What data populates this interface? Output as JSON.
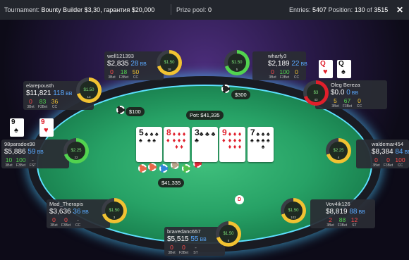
{
  "header": {
    "tournament_label": "Tournament:",
    "tournament_name": "Bounty Builder $3,30, гарантия $20,000",
    "prize_pool_label": "Prize pool:",
    "prize_pool_value": "0",
    "entries_label": "Entries:",
    "entries_value": "5407",
    "position_label": "Position:",
    "position_value": "130",
    "position_of": "of",
    "position_total": "3515",
    "close_icon": "close-icon"
  },
  "table": {
    "pot_label": "Pot: $41,335",
    "main_pot": "$41,335",
    "bet_300": "$300",
    "bet_100": "$100",
    "dealer_button": "D"
  },
  "board": [
    {
      "rank": "5",
      "suit": "♠",
      "color": "black"
    },
    {
      "rank": "8",
      "suit": "♦",
      "color": "red"
    },
    {
      "rank": "3",
      "suit": "♣",
      "color": "black"
    },
    {
      "rank": "9",
      "suit": "♦",
      "color": "red"
    },
    {
      "rank": "7",
      "suit": "♠",
      "color": "black"
    }
  ],
  "hero_cards": [
    {
      "rank": "Q",
      "suit": "♥",
      "color": "red"
    },
    {
      "rank": "Q",
      "suit": "♠",
      "color": "black"
    }
  ],
  "left_cards": [
    {
      "rank": "9",
      "suit": "♠",
      "color": "black"
    },
    {
      "rank": "9",
      "suit": "♥",
      "color": "red"
    }
  ],
  "seats": [
    {
      "name": "well121393",
      "stack": "$2,835",
      "bb": "28",
      "unit": "BB",
      "stats": [
        [
          "0",
          "r",
          "3Bet"
        ],
        [
          "18",
          "g",
          "F3Bet"
        ],
        [
          "50",
          "y",
          "CC"
        ]
      ],
      "ring": "$1.50",
      "ring_num": "18"
    },
    {
      "name": "wharfy3",
      "stack": "$2,189",
      "bb": "22",
      "unit": "BB",
      "stats": [
        [
          "0",
          "r",
          "3Bet"
        ],
        [
          "100",
          "g",
          "F3Bet"
        ],
        [
          "0",
          "y",
          "CC"
        ]
      ],
      "ring": "$1.50",
      "ring_num": "5"
    },
    {
      "name": "elarepousth",
      "stack": "$11,821",
      "bb": "118",
      "unit": "BB",
      "stats": [
        [
          "0",
          "r",
          "3Bet"
        ],
        [
          "83",
          "g",
          "F3Bet"
        ],
        [
          "36",
          "y",
          "CC"
        ]
      ],
      "ring": "$1.50",
      "ring_num": "13"
    },
    {
      "name": "Oleg Bereza",
      "stack": "$0.0",
      "bb": "0",
      "unit": "BB",
      "stats": [
        [
          "5",
          "y",
          "3Bet"
        ],
        [
          "67",
          "g",
          "F3Bet"
        ],
        [
          "0",
          "y",
          "CC"
        ]
      ],
      "ring": "$3",
      "ring_num": "43"
    },
    {
      "name": "98paradox98",
      "stack": "$5,886",
      "bb": "59",
      "unit": "BB",
      "stats": [
        [
          "10",
          "g",
          "3Bet"
        ],
        [
          "100",
          "g",
          "F3Bet"
        ],
        [
          "-",
          "gr",
          "FST"
        ]
      ],
      "ring": "$2.25",
      "ring_num": "22"
    },
    {
      "name": "waldemar454",
      "stack": "$8,384",
      "bb": "84",
      "unit": "BB",
      "stats": [
        [
          "0",
          "r",
          "3Bet"
        ],
        [
          "0",
          "r",
          "F3Bet"
        ],
        [
          "100",
          "r",
          "CC"
        ]
      ],
      "ring": "$2.25",
      "ring_num": "4"
    },
    {
      "name": "Mad_Therapis",
      "stack": "$3,636",
      "bb": "36",
      "unit": "BB",
      "stats": [
        [
          "0",
          "r",
          "3Bet"
        ],
        [
          "0",
          "r",
          "F3Bet"
        ],
        [
          "-",
          "gr",
          "CC"
        ]
      ],
      "ring": "$1.50",
      "ring_num": "3"
    },
    {
      "name": "Vov4ik126",
      "stack": "$8,819",
      "bb": "88",
      "unit": "BB",
      "stats": [
        [
          "2",
          "r",
          "3Bet"
        ],
        [
          "88",
          "g",
          "F3Bet"
        ],
        [
          "12",
          "r",
          "ST"
        ]
      ],
      "ring": "$1.50",
      "ring_num": "103"
    },
    {
      "name": "bravedanc657",
      "stack": "$5,515",
      "bb": "55",
      "unit": "BB",
      "stats": [
        [
          "0",
          "r",
          "3Bet"
        ],
        [
          "0",
          "r",
          "F3Bet"
        ],
        [
          "-",
          "gr",
          "ST"
        ]
      ],
      "ring": "$1.50",
      "ring_num": "6"
    }
  ],
  "colors": {
    "accent": "#5de0ff",
    "felt": "#27a266",
    "red": "#ff4b4b",
    "green": "#52d34f",
    "yellow": "#f1c232"
  }
}
